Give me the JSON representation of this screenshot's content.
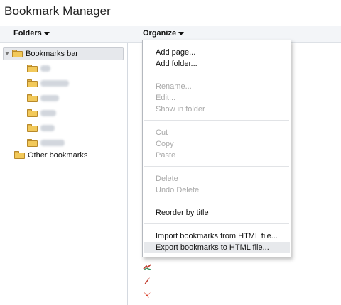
{
  "window": {
    "title": "Bookmark Manager"
  },
  "toolbar": {
    "folders_label": "Folders",
    "organize_label": "Organize"
  },
  "tree": {
    "bookmarks_bar": "Bookmarks bar",
    "other_bookmarks": "Other bookmarks"
  },
  "menu": {
    "add_page": "Add page...",
    "add_folder": "Add folder...",
    "rename": "Rename...",
    "edit": "Edit...",
    "show_in_folder": "Show in folder",
    "cut": "Cut",
    "copy": "Copy",
    "paste": "Paste",
    "delete": "Delete",
    "undo_delete": "Undo Delete",
    "reorder": "Reorder by title",
    "import": "Import bookmarks from HTML file...",
    "export": "Export bookmarks to HTML file..."
  },
  "colors": {
    "toolbar_bg": "#f3f5f8",
    "folder": "#f2c95a",
    "menu_highlight": "#e7e9ec",
    "disabled_text": "#a8a8a8"
  },
  "icons": [
    "folder-icon",
    "expander-arrow-icon",
    "caret-down-icon",
    "site-favicon"
  ]
}
